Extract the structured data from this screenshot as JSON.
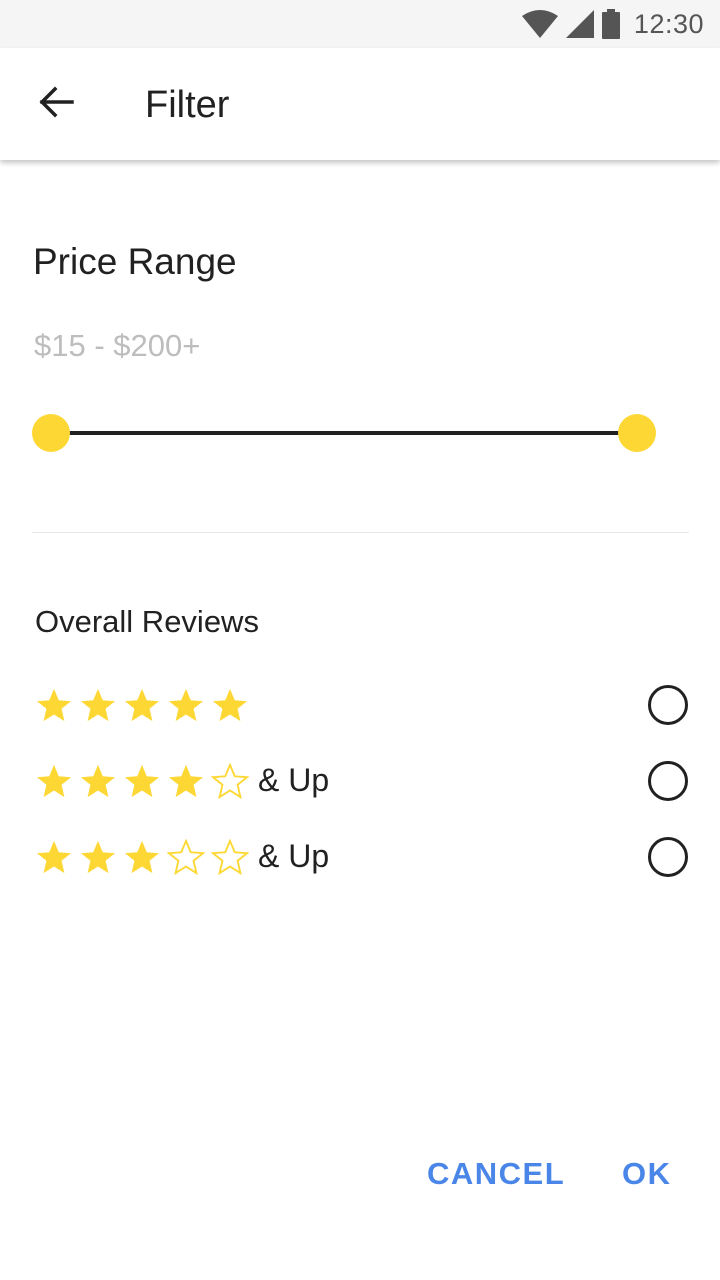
{
  "status_bar": {
    "time": "12:30",
    "icons": [
      "wifi-icon",
      "cell-signal-icon",
      "battery-icon"
    ]
  },
  "app_bar": {
    "title": "Filter",
    "back_icon": "arrow-back-icon"
  },
  "price_range": {
    "title": "Price Range",
    "value_text": "$15 - $200+",
    "slider_min_fraction": 0.0,
    "slider_max_fraction": 1.0
  },
  "reviews": {
    "title": "Overall Reviews",
    "options": [
      {
        "stars": 5,
        "label": "",
        "selected": false
      },
      {
        "stars": 4,
        "label": "& Up",
        "selected": false
      },
      {
        "stars": 3,
        "label": "& Up",
        "selected": false
      }
    ]
  },
  "actions": {
    "cancel_label": "CANCEL",
    "ok_label": "OK"
  },
  "colors": {
    "accent_star": "#fdd835",
    "button_text": "#4a86e8",
    "slider_track": "#212121"
  }
}
